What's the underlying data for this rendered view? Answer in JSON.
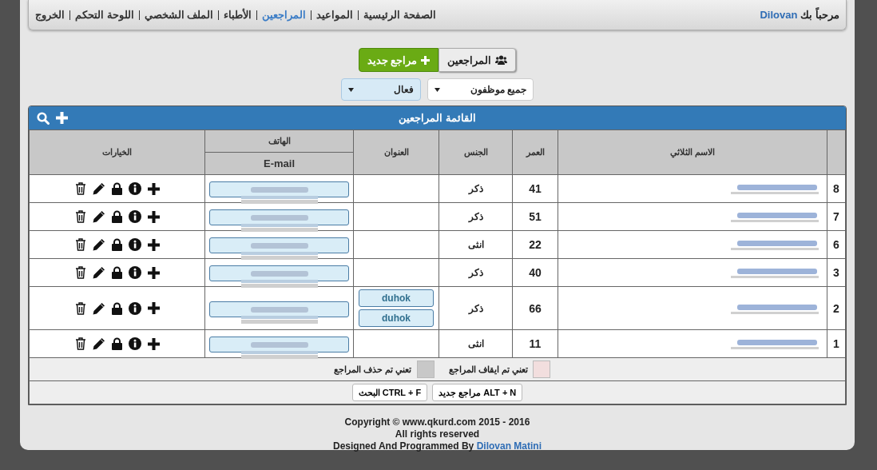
{
  "header": {
    "greeting": "مرحباً بك",
    "user": "Dilovan",
    "nav": [
      {
        "label": "الصفحة الرئيسية",
        "selected": false
      },
      {
        "label": "المواعيد",
        "selected": false
      },
      {
        "label": "المراجعين",
        "selected": true
      },
      {
        "label": "الأطباء",
        "selected": false
      },
      {
        "label": "الملف الشخصي",
        "selected": false
      },
      {
        "label": "اللوحة التحكم",
        "selected": false
      },
      {
        "label": "الخروج",
        "selected": false
      }
    ]
  },
  "toolbar": {
    "patients_button": "المراجعين",
    "new_button": "مراجع جديد"
  },
  "filters": [
    {
      "value": "جميع موظفون",
      "kind": "plain"
    },
    {
      "value": "فعال",
      "kind": "highlighted"
    }
  ],
  "panel": {
    "title": "القائمة المراجعين"
  },
  "table": {
    "columns": {
      "name": "الاسم الثلاثي",
      "age": "العمر",
      "gender": "الجنس",
      "address": "العنوان",
      "phone": "الهاتف",
      "email": "E-mail",
      "options": "الخيارات"
    },
    "rows": [
      {
        "index": "8",
        "age": "41",
        "gender": "ذكر",
        "addresses": []
      },
      {
        "index": "7",
        "age": "51",
        "gender": "ذكر",
        "addresses": []
      },
      {
        "index": "6",
        "age": "22",
        "gender": "انثى",
        "addresses": []
      },
      {
        "index": "3",
        "age": "40",
        "gender": "ذكر",
        "addresses": []
      },
      {
        "index": "2",
        "age": "66",
        "gender": "ذكر",
        "addresses": [
          "duhok",
          "duhok"
        ]
      },
      {
        "index": "1",
        "age": "11",
        "gender": "انثى",
        "addresses": []
      }
    ]
  },
  "legend": [
    {
      "label": "تعني تم ايقاف المراجع",
      "color": "#f2dede"
    },
    {
      "label": "تعني تم حذف المراجع",
      "color": "#c8c8c8"
    }
  ],
  "shortcuts": [
    "ALT + N مراجع جديد",
    "CTRL + F البحث"
  ],
  "footer": {
    "copyright": "Copyright © www.qkurd.com 2015 - 2016",
    "rights": "All rights reserved",
    "designed_by": "Designed And Programmed By",
    "author": "Dilovan Matini"
  }
}
